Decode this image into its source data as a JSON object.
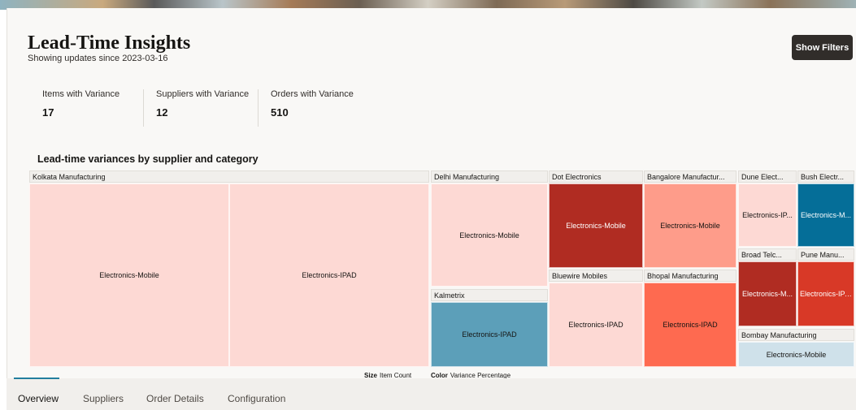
{
  "header": {
    "title": "Lead-Time Insights",
    "subtitle": "Showing updates since 2023-03-16",
    "filters_button": "Show Filters"
  },
  "metrics": [
    {
      "label": "Items with Variance",
      "value": "17"
    },
    {
      "label": "Suppliers with Variance",
      "value": "12"
    },
    {
      "label": "Orders with Variance",
      "value": "510"
    }
  ],
  "chart": {
    "title": "Lead-time variances by supplier and category",
    "legend": {
      "size_key": "Size",
      "size_value": "Item Count",
      "color_key": "Color",
      "color_value": "Variance Percentage"
    }
  },
  "chart_data": {
    "type": "treemap",
    "groups": [
      {
        "supplier": "Kolkata Manufacturing",
        "cells": [
          {
            "category": "Electronics-Mobile",
            "color": "#fdd9d4"
          },
          {
            "category": "Electronics-IPAD",
            "color": "#fdd9d4"
          }
        ]
      },
      {
        "supplier": "Delhi Manufacturing",
        "cells": [
          {
            "category": "Electronics-Mobile",
            "color": "#fdd9d4"
          }
        ]
      },
      {
        "supplier": "Kalmetrix",
        "cells": [
          {
            "category": "Electronics-IPAD",
            "color": "#5c9fb9"
          }
        ]
      },
      {
        "supplier": "Dot Electronics",
        "cells": [
          {
            "category": "Electronics-Mobile",
            "color": "#b02c22"
          }
        ]
      },
      {
        "supplier": "Bluewire Mobiles",
        "cells": [
          {
            "category": "Electronics-IPAD",
            "color": "#fdd9d4"
          }
        ]
      },
      {
        "supplier": "Bangalore Manufactur...",
        "cells": [
          {
            "category": "Electronics-Mobile",
            "color": "#fe9c8a"
          }
        ]
      },
      {
        "supplier": "Bhopal Manufacturing",
        "cells": [
          {
            "category": "Electronics-IPAD",
            "color": "#fe6a50"
          }
        ]
      },
      {
        "supplier": "Dune Elect...",
        "cells": [
          {
            "category": "Electronics-IP...",
            "color": "#fdd9d4"
          }
        ]
      },
      {
        "supplier": "Bush Electr...",
        "cells": [
          {
            "category": "Electronics-M...",
            "color": "#056e98"
          }
        ]
      },
      {
        "supplier": "Broad Telc...",
        "cells": [
          {
            "category": "Electronics-M...",
            "color": "#b02c22"
          }
        ]
      },
      {
        "supplier": "Pune Manu...",
        "cells": [
          {
            "category": "Electronics-IPAD",
            "color": "#d83927"
          }
        ]
      },
      {
        "supplier": "Bombay Manufacturing",
        "cells": [
          {
            "category": "Electronics-Mobile",
            "color": "#cfe1ea"
          }
        ]
      }
    ]
  },
  "tabs": [
    {
      "label": "Overview",
      "active": true
    },
    {
      "label": "Suppliers",
      "active": false
    },
    {
      "label": "Order Details",
      "active": false
    },
    {
      "label": "Configuration",
      "active": false
    }
  ]
}
